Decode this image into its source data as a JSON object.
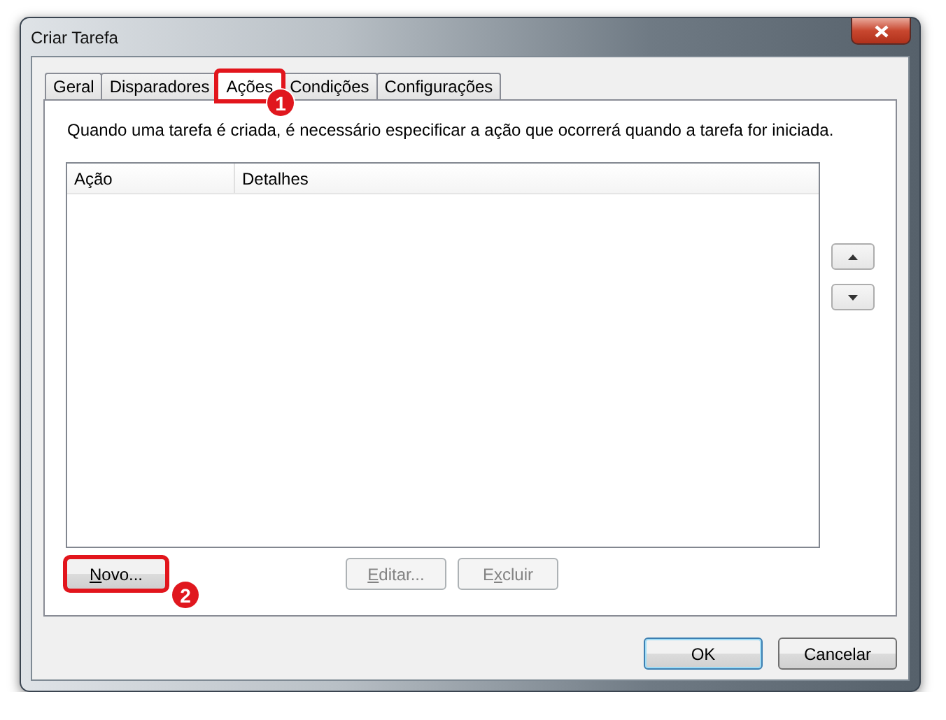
{
  "window": {
    "title": "Criar Tarefa"
  },
  "tabs": [
    {
      "label": "Geral",
      "selected": false,
      "highlighted": false
    },
    {
      "label": "Disparadores",
      "selected": false,
      "highlighted": false
    },
    {
      "label": "Ações",
      "selected": true,
      "highlighted": true,
      "callout": "1"
    },
    {
      "label": "Condições",
      "selected": false,
      "highlighted": false
    },
    {
      "label": "Configurações",
      "selected": false,
      "highlighted": false
    }
  ],
  "description": "Quando uma tarefa é criada, é necessário especificar a ação que ocorrerá quando a tarefa for iniciada.",
  "table": {
    "columns": [
      "Ação",
      "Detalhes"
    ]
  },
  "move_buttons": [
    {
      "kind": "up"
    },
    {
      "kind": "down"
    }
  ],
  "action_buttons": [
    {
      "access_key": "N",
      "rest": "ovo...",
      "disabled": false,
      "highlighted": true,
      "callout": "2"
    },
    {
      "access_key": "E",
      "rest": "ditar...",
      "disabled": true,
      "highlighted": false
    },
    {
      "lead": "E",
      "access_key": "x",
      "rest": "cluir",
      "disabled": true,
      "highlighted": false
    }
  ],
  "dialog_buttons": [
    {
      "label": "OK",
      "default": true
    },
    {
      "label": "Cancelar",
      "default": false
    }
  ]
}
